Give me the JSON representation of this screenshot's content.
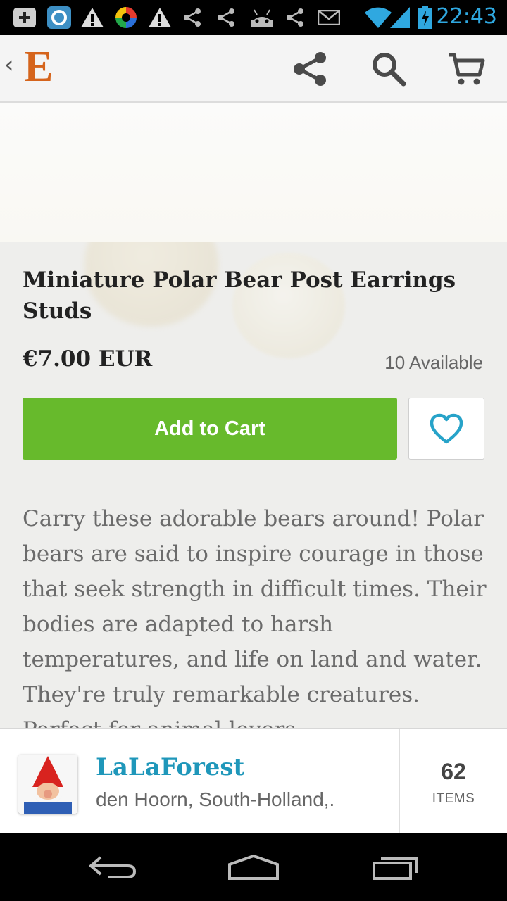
{
  "status_bar": {
    "time": "22:43",
    "time_color": "#2fa8e0",
    "icons": [
      "plus-square-icon",
      "app-square-icon",
      "warning-icon",
      "color-wheel-icon",
      "warning-icon",
      "share-icon",
      "share-icon",
      "android-icon",
      "share-icon",
      "mail-icon",
      "wifi-icon",
      "signal-icon",
      "battery-charging-icon"
    ]
  },
  "action_bar": {
    "back_chevron": "‹",
    "logo_letter": "E",
    "logo_color": "#d5641c",
    "actions": [
      "share-icon",
      "search-icon",
      "cart-icon"
    ]
  },
  "listing": {
    "title": "Miniature Polar Bear Post Earrings Studs",
    "price": "€7.00 EUR",
    "availability": "10 Available",
    "add_to_cart_label": "Add to Cart",
    "cart_button_color": "#67ba2c",
    "favorite_icon": "heart-outline-icon",
    "favorite_color": "#27a3c9",
    "description": "Carry these adorable bears around! Polar bears are said to inspire courage in those that seek strength in difficult times. Their bodies are adapted to harsh temperatures, and life on land and water. They're truly remarkable creatures. Perfect for animal lovers."
  },
  "shop": {
    "name": "LaLaForest",
    "name_color": "#1f97ba",
    "location": "den Hoorn, South-Holland,.",
    "item_count": "62",
    "item_count_label": "ITEMS"
  },
  "nav_bar": {
    "buttons": [
      "back-icon",
      "home-icon",
      "recent-apps-icon"
    ]
  }
}
